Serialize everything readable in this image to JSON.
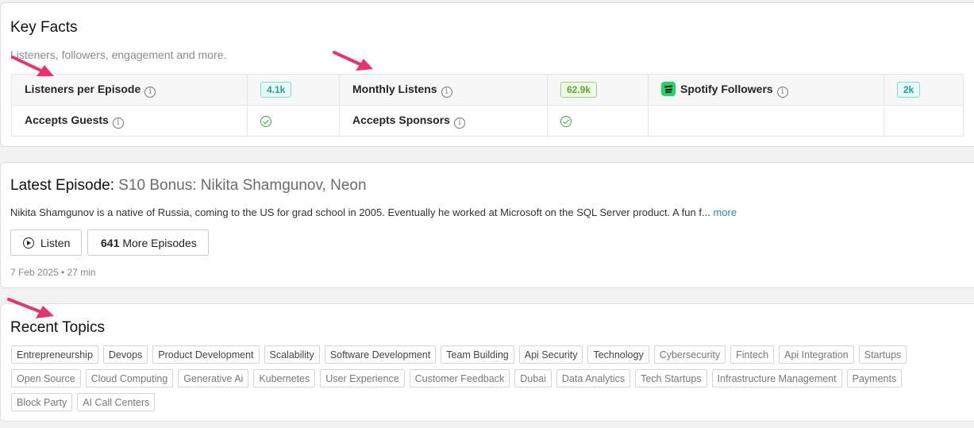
{
  "key_facts": {
    "title": "Key Facts",
    "subtitle": "Listeners, followers, engagement and more.",
    "rows": [
      [
        {
          "label": "Listeners per Episode",
          "value": "4.1k"
        },
        {
          "label": "Monthly Listens",
          "value": "62.9k"
        },
        {
          "label": "Spotify Followers",
          "value": "2k"
        }
      ],
      [
        {
          "label": "Accepts Guests",
          "value": "yes"
        },
        {
          "label": "Accepts Sponsors",
          "value": "yes"
        }
      ]
    ],
    "info_glyph": "i"
  },
  "latest_episode": {
    "heading": "Latest Episode:",
    "name": "S10 Bonus: Nikita Shamgunov, Neon",
    "description": "Nikita Shamgunov is a native of Russia, coming to the US for grad school in 2005. Eventually he worked at Microsoft on the SQL Server product. A fun f...",
    "more_label": "more",
    "listen_label": "Listen",
    "episode_count": "641",
    "more_episodes_label": "More Episodes",
    "meta": "7 Feb 2025 • 27 min"
  },
  "recent_topics": {
    "title": "Recent Topics",
    "topics": [
      "Entrepreneurship",
      "Devops",
      "Product Development",
      "Scalability",
      "Software Development",
      "Team Building",
      "Api Security",
      "Technology",
      "Cybersecurity",
      "Fintech",
      "Api Integration",
      "Startups",
      "Open Source",
      "Cloud Computing",
      "Generative Ai",
      "Kubernetes",
      "User Experience",
      "Customer Feedback",
      "Dubai",
      "Data Analytics",
      "Tech Startups",
      "Infrastructure Management",
      "Payments",
      "Block Party",
      "AI Call Centers"
    ]
  },
  "colors": {
    "annotation_arrow": "#e8346b",
    "badge_teal": "#1aa39a",
    "badge_green": "#5caa22",
    "check_green": "#3fa93f",
    "link_blue": "#2585c8",
    "spotify_green": "#1ed760"
  }
}
